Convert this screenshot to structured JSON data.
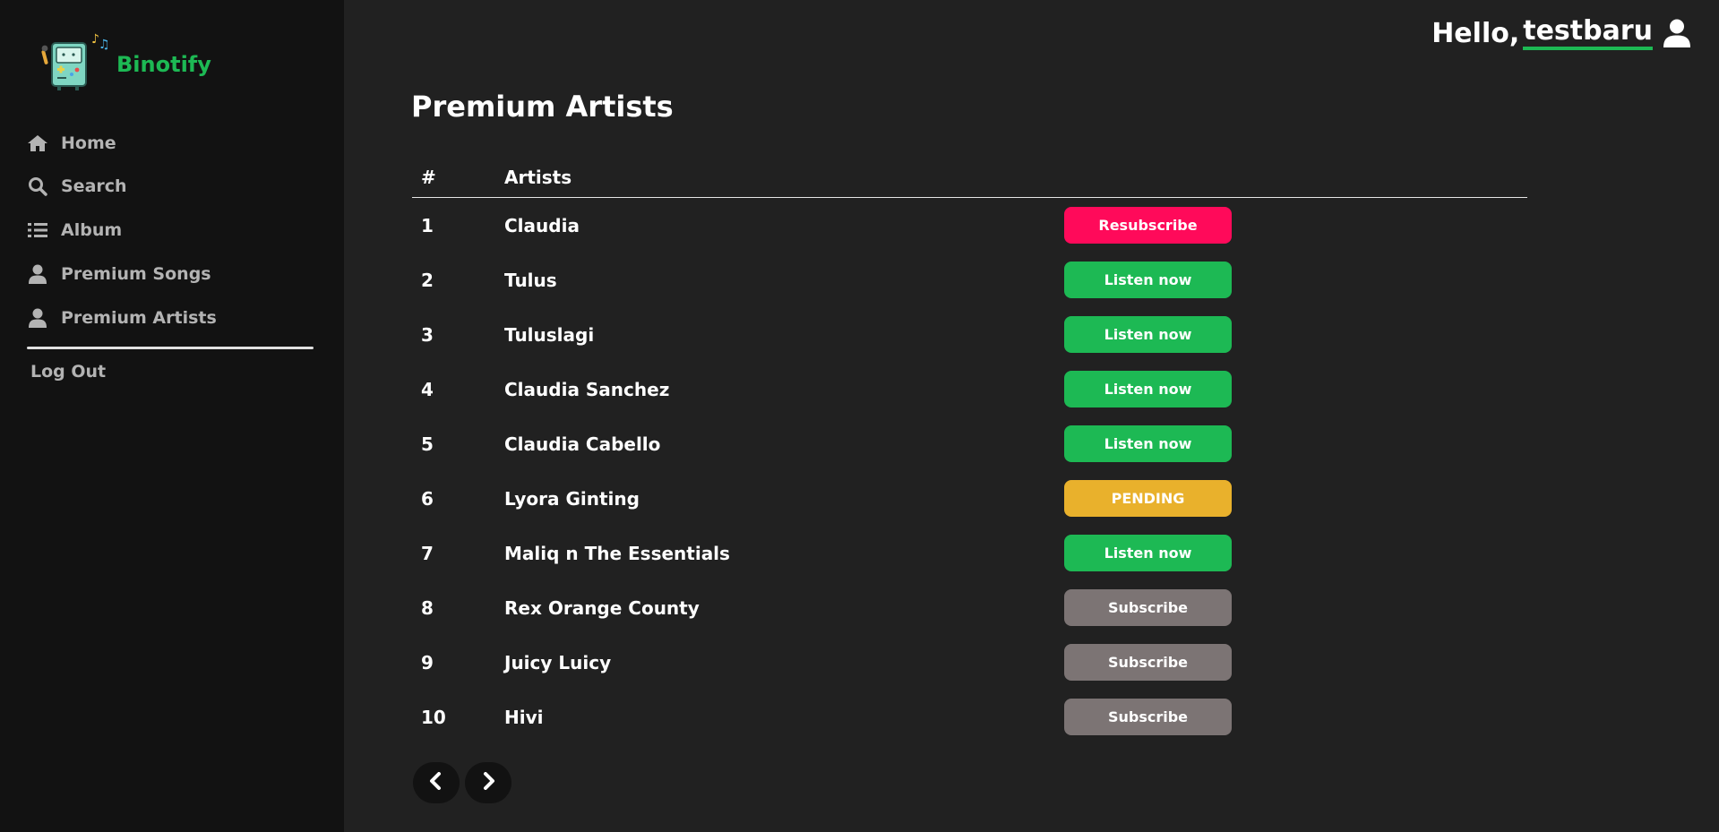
{
  "app": {
    "name": "Binotify"
  },
  "sidebar": {
    "items": [
      {
        "label": "Home",
        "icon": "home-icon"
      },
      {
        "label": "Search",
        "icon": "search-icon"
      },
      {
        "label": "Album",
        "icon": "list-icon"
      },
      {
        "label": "Premium Songs",
        "icon": "user-icon"
      },
      {
        "label": "Premium Artists",
        "icon": "user-icon"
      }
    ],
    "logout_label": "Log Out"
  },
  "header": {
    "greeting": "Hello,",
    "username": "testbaru",
    "icon": "user-icon"
  },
  "page": {
    "title": "Premium Artists"
  },
  "table": {
    "headers": {
      "num": "#",
      "artist": "Artists"
    },
    "rows": [
      {
        "num": "1",
        "name": "Claudia",
        "action": "Resubscribe",
        "status": "resubscribe"
      },
      {
        "num": "2",
        "name": "Tulus",
        "action": "Listen now",
        "status": "listen"
      },
      {
        "num": "3",
        "name": "Tuluslagi",
        "action": "Listen now",
        "status": "listen"
      },
      {
        "num": "4",
        "name": "Claudia Sanchez",
        "action": "Listen now",
        "status": "listen"
      },
      {
        "num": "5",
        "name": "Claudia Cabello",
        "action": "Listen now",
        "status": "listen"
      },
      {
        "num": "6",
        "name": "Lyora Ginting",
        "action": "PENDING",
        "status": "pending"
      },
      {
        "num": "7",
        "name": "Maliq n The Essentials",
        "action": "Listen now",
        "status": "listen"
      },
      {
        "num": "8",
        "name": "Rex Orange County",
        "action": "Subscribe",
        "status": "subscribe"
      },
      {
        "num": "9",
        "name": "Juicy Luicy",
        "action": "Subscribe",
        "status": "subscribe"
      },
      {
        "num": "10",
        "name": "Hivi",
        "action": "Subscribe",
        "status": "subscribe"
      }
    ]
  },
  "pagination": {
    "prev_icon": "chevron-left-icon",
    "next_icon": "chevron-right-icon"
  },
  "colors": {
    "accent": "#1db954",
    "resubscribe": "#ff0a5a",
    "listen": "#1db954",
    "pending": "#e9b12c",
    "subscribe": "#7c7474"
  }
}
